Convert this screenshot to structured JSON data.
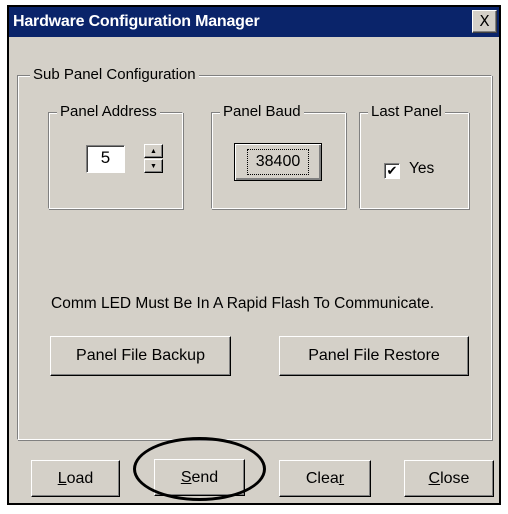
{
  "window": {
    "title": "Hardware Configuration Manager",
    "close_glyph": "X"
  },
  "sub_panel": {
    "legend": "Sub Panel Configuration",
    "panel_address": {
      "legend": "Panel Address",
      "value": "5",
      "up_glyph": "▲",
      "down_glyph": "▼"
    },
    "panel_baud": {
      "legend": "Panel Baud",
      "button_label": "38400"
    },
    "last_panel": {
      "legend": "Last Panel",
      "checkbox_label": "Yes",
      "checked": true,
      "check_glyph": "✔"
    },
    "comm_message": "Comm LED Must Be In A Rapid Flash To Communicate.",
    "backup_button": "Panel File Backup",
    "restore_button": "Panel File Restore"
  },
  "footer": {
    "load": {
      "accel": "L",
      "rest": "oad"
    },
    "send": {
      "accel": "S",
      "rest": "end"
    },
    "clear": {
      "pre": "Clea",
      "accel": "r"
    },
    "close": {
      "accel": "C",
      "rest": "lose"
    }
  }
}
